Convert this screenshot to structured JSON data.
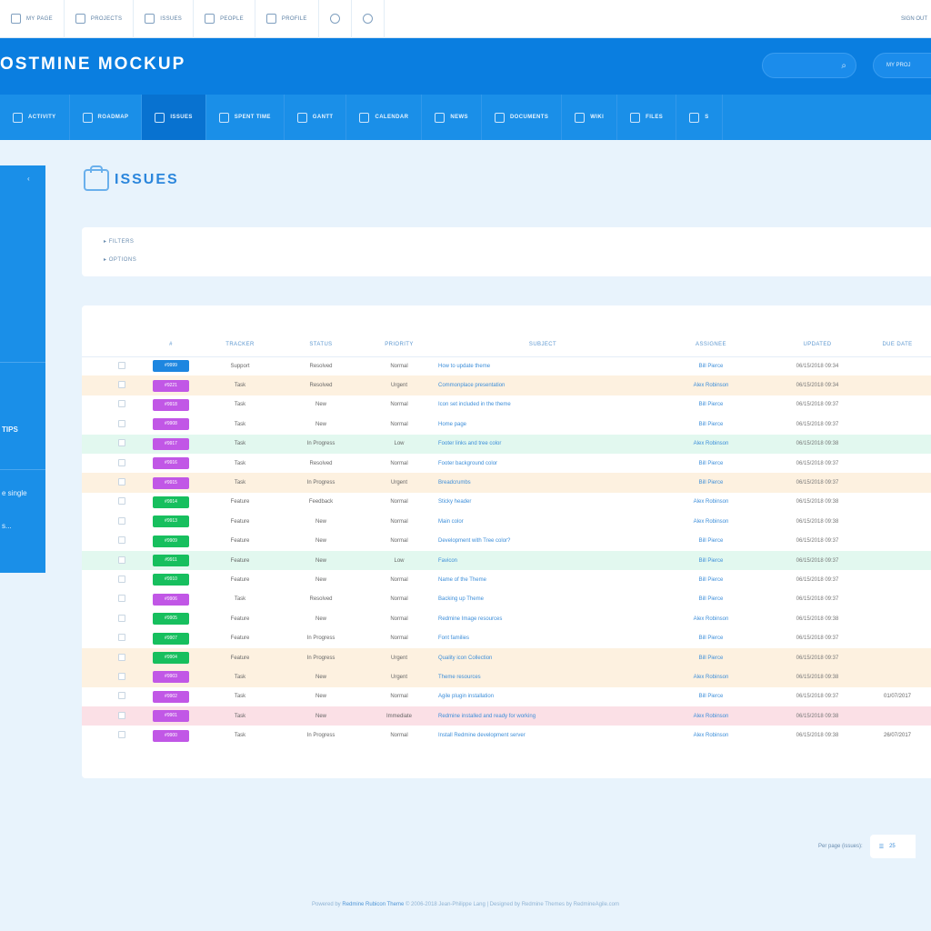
{
  "topbar": {
    "items": [
      {
        "label": "MY PAGE",
        "icon": "home-icon"
      },
      {
        "label": "PROJECTS",
        "icon": "folder-icon"
      },
      {
        "label": "ISSUES",
        "icon": "list-icon"
      },
      {
        "label": "PEOPLE",
        "icon": "users-icon"
      },
      {
        "label": "PROFILE",
        "icon": "user-icon"
      },
      {
        "label": "",
        "icon": "help-icon"
      },
      {
        "label": "",
        "icon": "settings-icon"
      }
    ],
    "right_label": "SIGN OUT"
  },
  "header": {
    "brand": "OSTMINE MOCKUP",
    "search_icon": "search-icon",
    "project_button": "MY PROJ"
  },
  "tabs": [
    {
      "label": "ACTIVITY",
      "icon": "activity-icon",
      "active": false
    },
    {
      "label": "ROADMAP",
      "icon": "roadmap-icon",
      "active": false
    },
    {
      "label": "ISSUES",
      "icon": "issues-icon",
      "active": true
    },
    {
      "label": "SPENT TIME",
      "icon": "clock-icon",
      "active": false
    },
    {
      "label": "GANTT",
      "icon": "gantt-icon",
      "active": false
    },
    {
      "label": "CALENDAR",
      "icon": "calendar-icon",
      "active": false
    },
    {
      "label": "NEWS",
      "icon": "news-icon",
      "active": false
    },
    {
      "label": "DOCUMENTS",
      "icon": "documents-icon",
      "active": false
    },
    {
      "label": "WIKI",
      "icon": "wiki-icon",
      "active": false
    },
    {
      "label": "FILES",
      "icon": "files-icon",
      "active": false
    },
    {
      "label": "S",
      "icon": "settings-icon",
      "active": false
    }
  ],
  "sidebar": {
    "collapse": "‹",
    "text_1": "TIPS",
    "text_2": "e single",
    "text_3": "s..."
  },
  "page": {
    "title": "ISSUES",
    "filters_label": "FILTERS",
    "options_label": "OPTIONS"
  },
  "table": {
    "columns": [
      "#",
      "TRACKER",
      "STATUS",
      "PRIORITY",
      "SUBJECT",
      "ASSIGNEE",
      "UPDATED",
      "DUE DATE"
    ],
    "rows": [
      {
        "id": "#9999",
        "color": "blue",
        "tracker": "Support",
        "status": "Resolved",
        "priority": "Normal",
        "subject": "How to update theme",
        "assignee": "Bill Pierce",
        "updated": "06/15/2018 09:34",
        "due": "",
        "row": ""
      },
      {
        "id": "#9221",
        "color": "purple",
        "tracker": "Task",
        "status": "Resolved",
        "priority": "Urgent",
        "subject": "Commonplace presentation",
        "assignee": "Alex Robinson",
        "updated": "06/15/2018 09:34",
        "due": "",
        "row": "orange"
      },
      {
        "id": "#9918",
        "color": "purple",
        "tracker": "Task",
        "status": "New",
        "priority": "Normal",
        "subject": "Icon set included in the theme",
        "assignee": "Bill Pierce",
        "updated": "06/15/2018 09:37",
        "due": "",
        "row": ""
      },
      {
        "id": "#9908",
        "color": "purple",
        "tracker": "Task",
        "status": "New",
        "priority": "Normal",
        "subject": "Home page",
        "assignee": "Bill Pierce",
        "updated": "06/15/2018 09:37",
        "due": "",
        "row": ""
      },
      {
        "id": "#9917",
        "color": "purple",
        "tracker": "Task",
        "status": "In Progress",
        "priority": "Low",
        "subject": "Footer links and tree color",
        "assignee": "Alex Robinson",
        "updated": "06/15/2018 09:38",
        "due": "",
        "row": "green"
      },
      {
        "id": "#9916",
        "color": "purple",
        "tracker": "Task",
        "status": "Resolved",
        "priority": "Normal",
        "subject": "Footer background color",
        "assignee": "Bill Pierce",
        "updated": "06/15/2018 09:37",
        "due": "",
        "row": ""
      },
      {
        "id": "#9915",
        "color": "purple",
        "tracker": "Task",
        "status": "In Progress",
        "priority": "Urgent",
        "subject": "Breadcrumbs",
        "assignee": "Bill Pierce",
        "updated": "06/15/2018 09:37",
        "due": "",
        "row": "orange"
      },
      {
        "id": "#9914",
        "color": "green",
        "tracker": "Feature",
        "status": "Feedback",
        "priority": "Normal",
        "subject": "Sticky header",
        "assignee": "Alex Robinson",
        "updated": "06/15/2018 09:38",
        "due": "",
        "row": ""
      },
      {
        "id": "#9913",
        "color": "green",
        "tracker": "Feature",
        "status": "New",
        "priority": "Normal",
        "subject": "Main color",
        "assignee": "Alex Robinson",
        "updated": "06/15/2018 09:38",
        "due": "",
        "row": ""
      },
      {
        "id": "#9909",
        "color": "green",
        "tracker": "Feature",
        "status": "New",
        "priority": "Normal",
        "subject": "Development with Tree color?",
        "assignee": "Bill Pierce",
        "updated": "06/15/2018 09:37",
        "due": "",
        "row": ""
      },
      {
        "id": "#9911",
        "color": "green",
        "tracker": "Feature",
        "status": "New",
        "priority": "Low",
        "subject": "Favicon",
        "assignee": "Bill Pierce",
        "updated": "06/15/2018 09:37",
        "due": "",
        "row": "green"
      },
      {
        "id": "#9910",
        "color": "green",
        "tracker": "Feature",
        "status": "New",
        "priority": "Normal",
        "subject": "Name of the Theme",
        "assignee": "Bill Pierce",
        "updated": "06/15/2018 09:37",
        "due": "",
        "row": ""
      },
      {
        "id": "#9906",
        "color": "purple",
        "tracker": "Task",
        "status": "Resolved",
        "priority": "Normal",
        "subject": "Backing up Theme",
        "assignee": "Bill Pierce",
        "updated": "06/15/2018 09:37",
        "due": "",
        "row": ""
      },
      {
        "id": "#9905",
        "color": "green",
        "tracker": "Feature",
        "status": "New",
        "priority": "Normal",
        "subject": "Redmine Image resources",
        "assignee": "Alex Robinson",
        "updated": "06/15/2018 09:38",
        "due": "",
        "row": ""
      },
      {
        "id": "#9907",
        "color": "green",
        "tracker": "Feature",
        "status": "In Progress",
        "priority": "Normal",
        "subject": "Font families",
        "assignee": "Bill Pierce",
        "updated": "06/15/2018 09:37",
        "due": "",
        "row": ""
      },
      {
        "id": "#9904",
        "color": "green",
        "tracker": "Feature",
        "status": "In Progress",
        "priority": "Urgent",
        "subject": "Quality icon Collection",
        "assignee": "Bill Pierce",
        "updated": "06/15/2018 09:37",
        "due": "",
        "row": "orange"
      },
      {
        "id": "#9903",
        "color": "purple",
        "tracker": "Task",
        "status": "New",
        "priority": "Urgent",
        "subject": "Theme resources",
        "assignee": "Alex Robinson",
        "updated": "06/15/2018 09:38",
        "due": "",
        "row": "orange"
      },
      {
        "id": "#9902",
        "color": "purple",
        "tracker": "Task",
        "status": "New",
        "priority": "Normal",
        "subject": "Agile plugin installation",
        "assignee": "Bill Pierce",
        "updated": "06/15/2018 09:37",
        "due": "01/07/2017",
        "row": ""
      },
      {
        "id": "#9901",
        "color": "purple",
        "tracker": "Task",
        "status": "New",
        "priority": "Immediate",
        "subject": "Redmine installed and ready for working",
        "assignee": "Alex Robinson",
        "updated": "06/15/2018 09:38",
        "due": "",
        "row": "red"
      },
      {
        "id": "#9900",
        "color": "purple",
        "tracker": "Task",
        "status": "In Progress",
        "priority": "Normal",
        "subject": "Install Redmine development server",
        "assignee": "Alex Robinson",
        "updated": "06/15/2018 09:38",
        "due": "26/07/2017",
        "row": ""
      }
    ]
  },
  "perpage": {
    "label": "Per page (issues):",
    "value": "25"
  },
  "footer": {
    "prefix": "Powered by",
    "link": "Redmine Rubicon Theme",
    "suffix": "© 2006-2018 Jean-Philippe Lang | Designed by Redmine Themes by RedmineAgile.com"
  }
}
